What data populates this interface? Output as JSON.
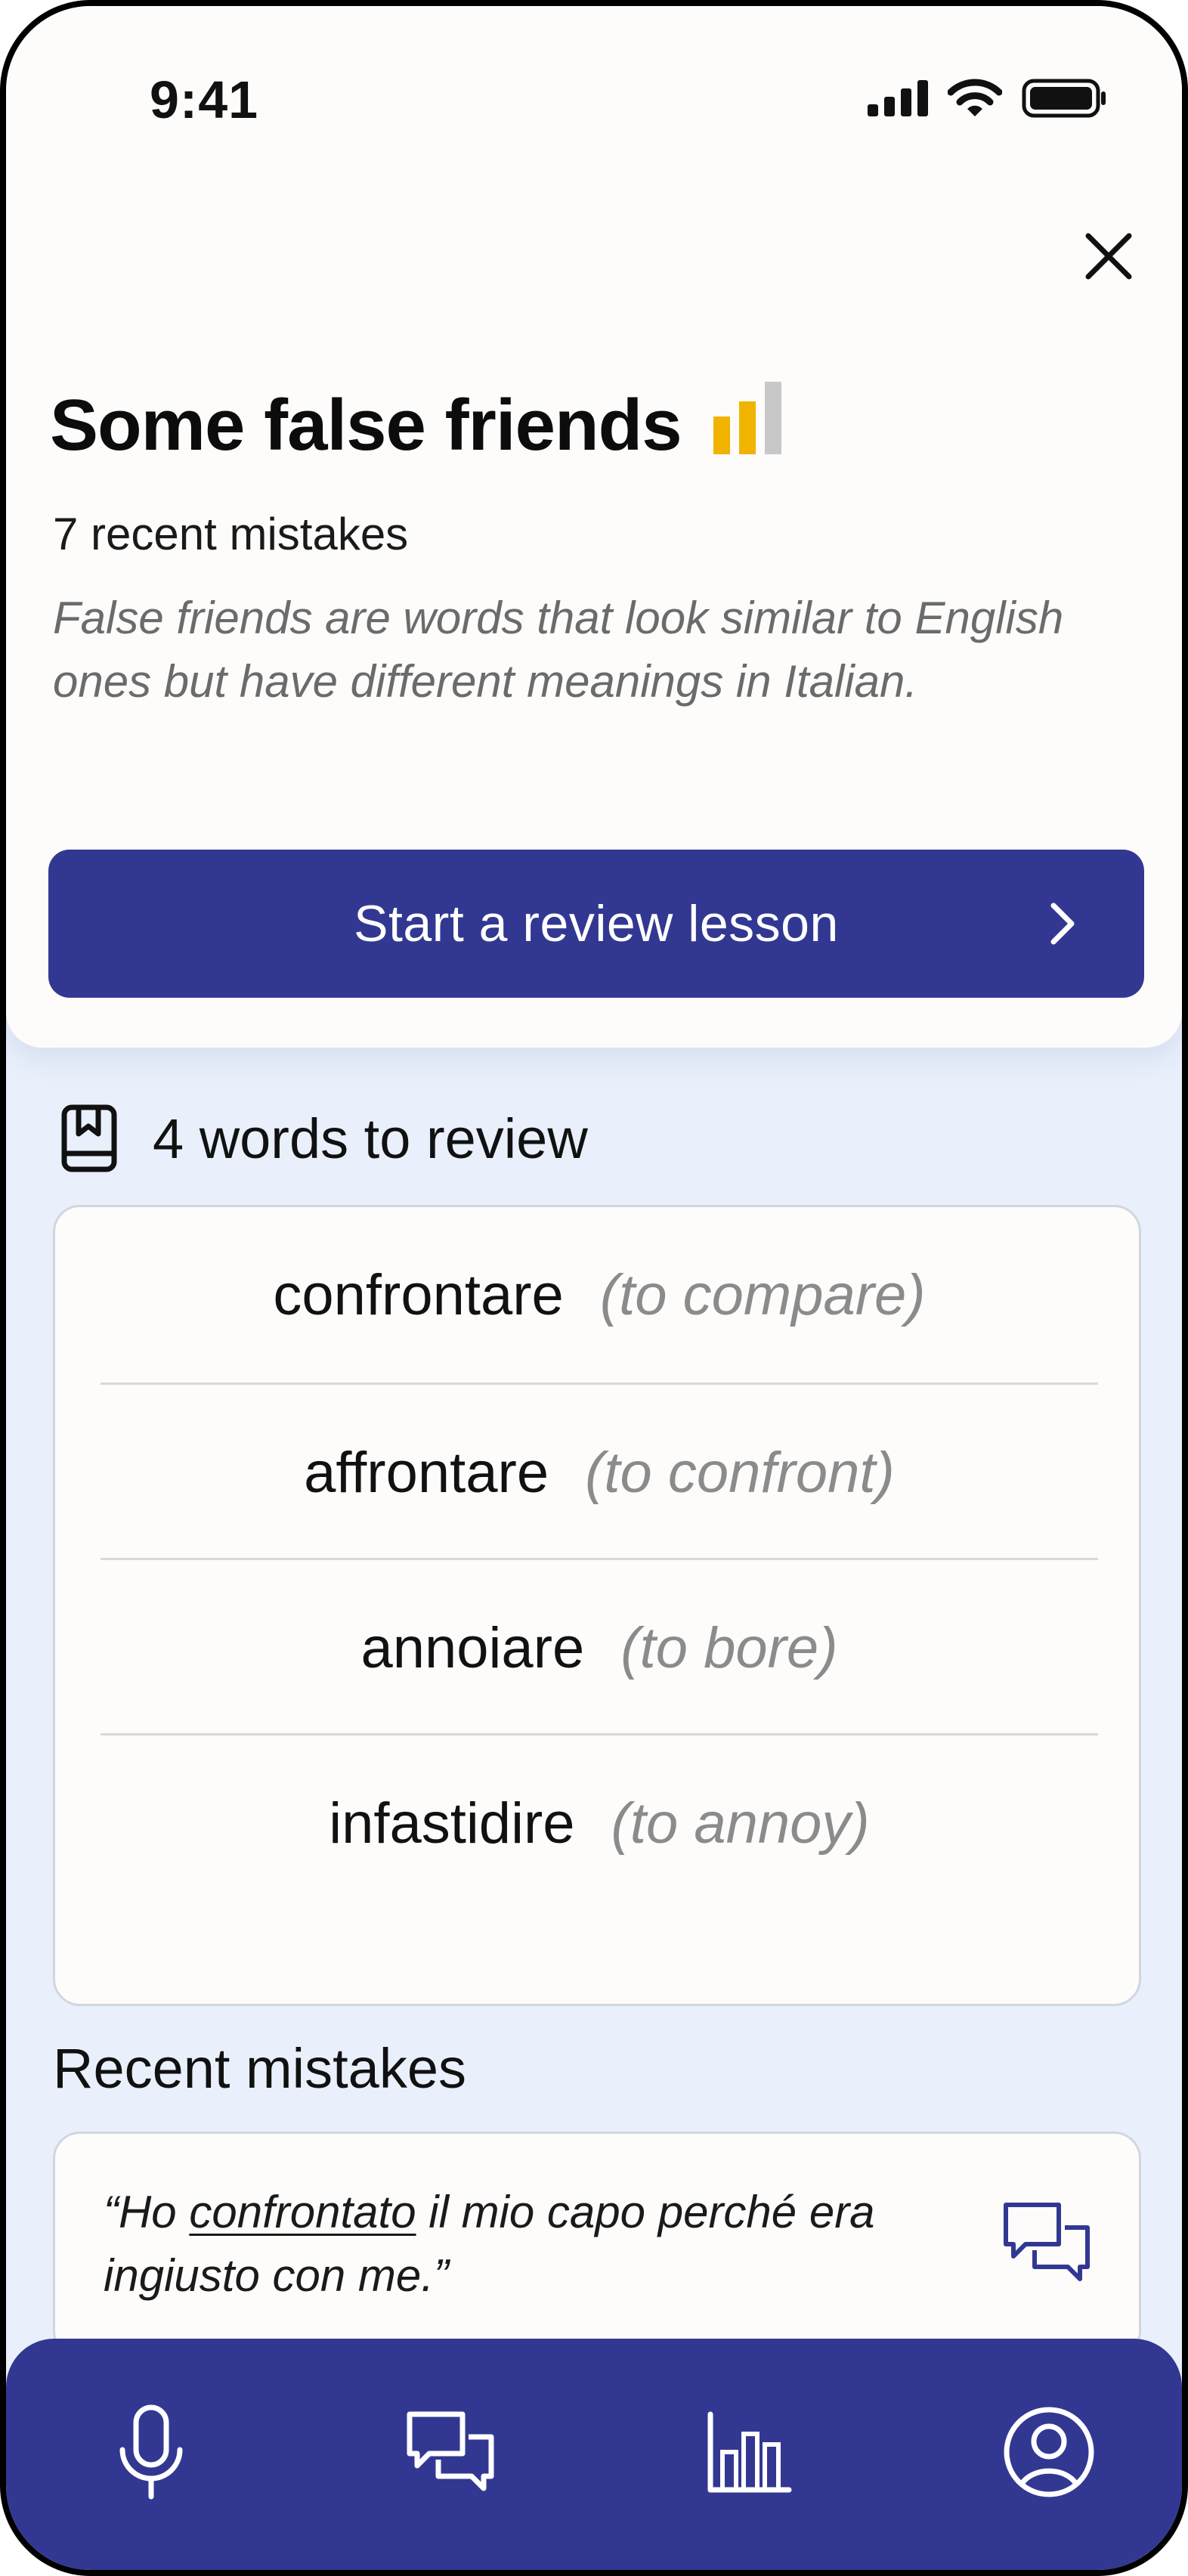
{
  "status_bar": {
    "time": "9:41"
  },
  "header": {
    "title": "Some false friends",
    "subtitle": "7 recent mistakes",
    "description": "False friends are words that look similar to English ones but have different meanings in Italian.",
    "level_icon": "signal-bars-icon",
    "level_value": 2,
    "level_max": 3
  },
  "cta": {
    "label": "Start a review lesson"
  },
  "review": {
    "heading": "4 words to review",
    "words": [
      {
        "word": "confrontare",
        "translation": "(to compare)"
      },
      {
        "word": "affrontare",
        "translation": "(to confront)"
      },
      {
        "word": "annoiare",
        "translation": "(to bore)"
      },
      {
        "word": "infastidire",
        "translation": "(to annoy)"
      }
    ]
  },
  "mistakes": {
    "heading": "Recent mistakes",
    "items": [
      {
        "before": "“Ho ",
        "highlight": "confrontato",
        "after": " il mio capo perché era ingiusto con me.”"
      }
    ]
  },
  "tabs": [
    {
      "icon": "microphone-icon"
    },
    {
      "icon": "chat-icon"
    },
    {
      "icon": "bar-chart-icon"
    },
    {
      "icon": "profile-icon"
    }
  ],
  "colors": {
    "accent": "#323891",
    "background": "#e9f0fc",
    "level_active": "#f0b400",
    "level_inactive": "#c8c8c8"
  }
}
